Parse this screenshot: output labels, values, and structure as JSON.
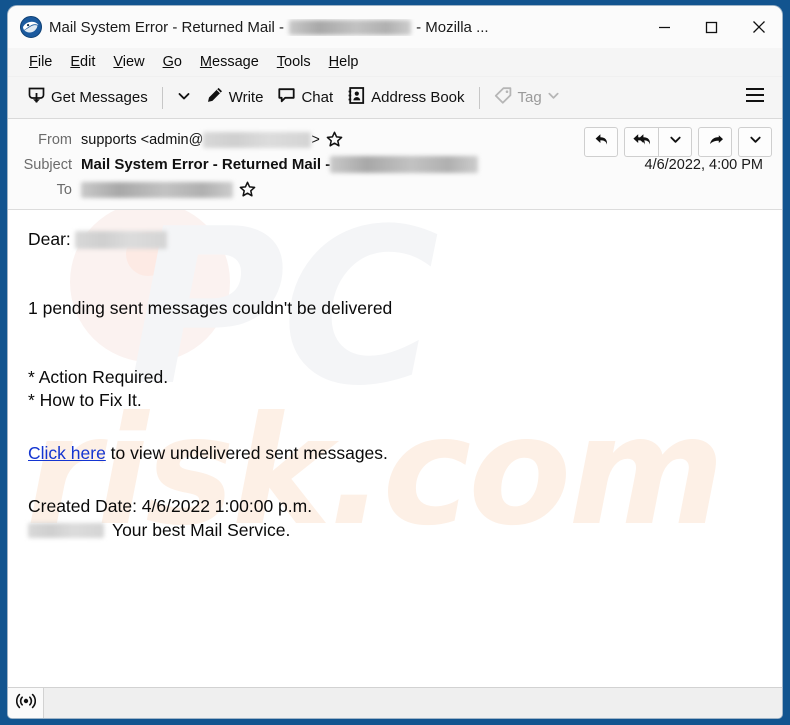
{
  "window": {
    "title_prefix": "Mail System Error - Returned Mail - ",
    "title_suffix": " - Mozilla ...",
    "title_redacted": true,
    "app_icon": "thunderbird-icon",
    "minimize_label": "Minimize",
    "maximize_label": "Maximize",
    "close_label": "Close",
    "frame_color": "#12548f"
  },
  "menubar": {
    "items": [
      {
        "accesskey": "F",
        "rest": "ile"
      },
      {
        "accesskey": "E",
        "rest": "dit"
      },
      {
        "accesskey": "V",
        "rest": "iew"
      },
      {
        "accesskey": "G",
        "rest": "o"
      },
      {
        "accesskey": "M",
        "rest": "essage"
      },
      {
        "accesskey": "T",
        "rest": "ools"
      },
      {
        "accesskey": "H",
        "rest": "elp"
      }
    ]
  },
  "toolbar": {
    "get_messages_label": "Get Messages",
    "get_messages_icon": "inbox-download-icon",
    "get_messages_dropdown_icon": "chevron-down-icon",
    "write_label": "Write",
    "write_icon": "pencil-icon",
    "chat_label": "Chat",
    "chat_icon": "speech-bubble-icon",
    "address_book_label": "Address Book",
    "address_book_icon": "contact-card-icon",
    "tag_label": "Tag",
    "tag_icon": "tag-icon",
    "tag_dropdown_icon": "chevron-down-icon",
    "tag_disabled": true,
    "app_menu_icon": "hamburger-icon"
  },
  "message_header": {
    "from_label": "From",
    "from_value": "supports <admin@",
    "from_value_suffix": ">",
    "from_redacted": true,
    "from_star_icon": "star-outline-icon",
    "subject_label": "Subject",
    "subject_value": "Mail System Error - Returned Mail - ",
    "subject_redacted": true,
    "date": "4/6/2022, 4:00 PM",
    "to_label": "To",
    "to_redacted": true,
    "to_star_icon": "star-outline-icon",
    "actions": [
      {
        "name": "reply-button",
        "icon": "reply-arrow-icon"
      },
      {
        "name": "reply-all-button",
        "icon": "reply-all-arrow-icon"
      },
      {
        "name": "reply-all-dropdown",
        "icon": "chevron-down-icon"
      },
      {
        "name": "forward-button",
        "icon": "forward-arrow-icon"
      },
      {
        "name": "more-actions-dropdown",
        "icon": "chevron-down-icon"
      }
    ]
  },
  "body": {
    "greeting_label": "Dear:",
    "greeting_redacted": true,
    "line_pending": "1 pending sent messages couldn't be delivered",
    "line_action": "* Action Required.",
    "line_howto": "* How to Fix It.",
    "link_text": "Click here",
    "link_rest": " to view undelivered sent messages.",
    "created_date": "Created Date: 4/6/2022 1:00:00 p.m.",
    "signature_redacted": true,
    "signature_text": "Your best Mail Service.",
    "link_color": "#1435d1"
  },
  "statusbar": {
    "online_icon": "broadcast-online-icon",
    "status_text": ""
  },
  "watermark": {
    "text_top": "PC",
    "text_bottom": "risk.com",
    "color_top": "#f4f5f7",
    "color_bottom": "#fdf0e6"
  }
}
